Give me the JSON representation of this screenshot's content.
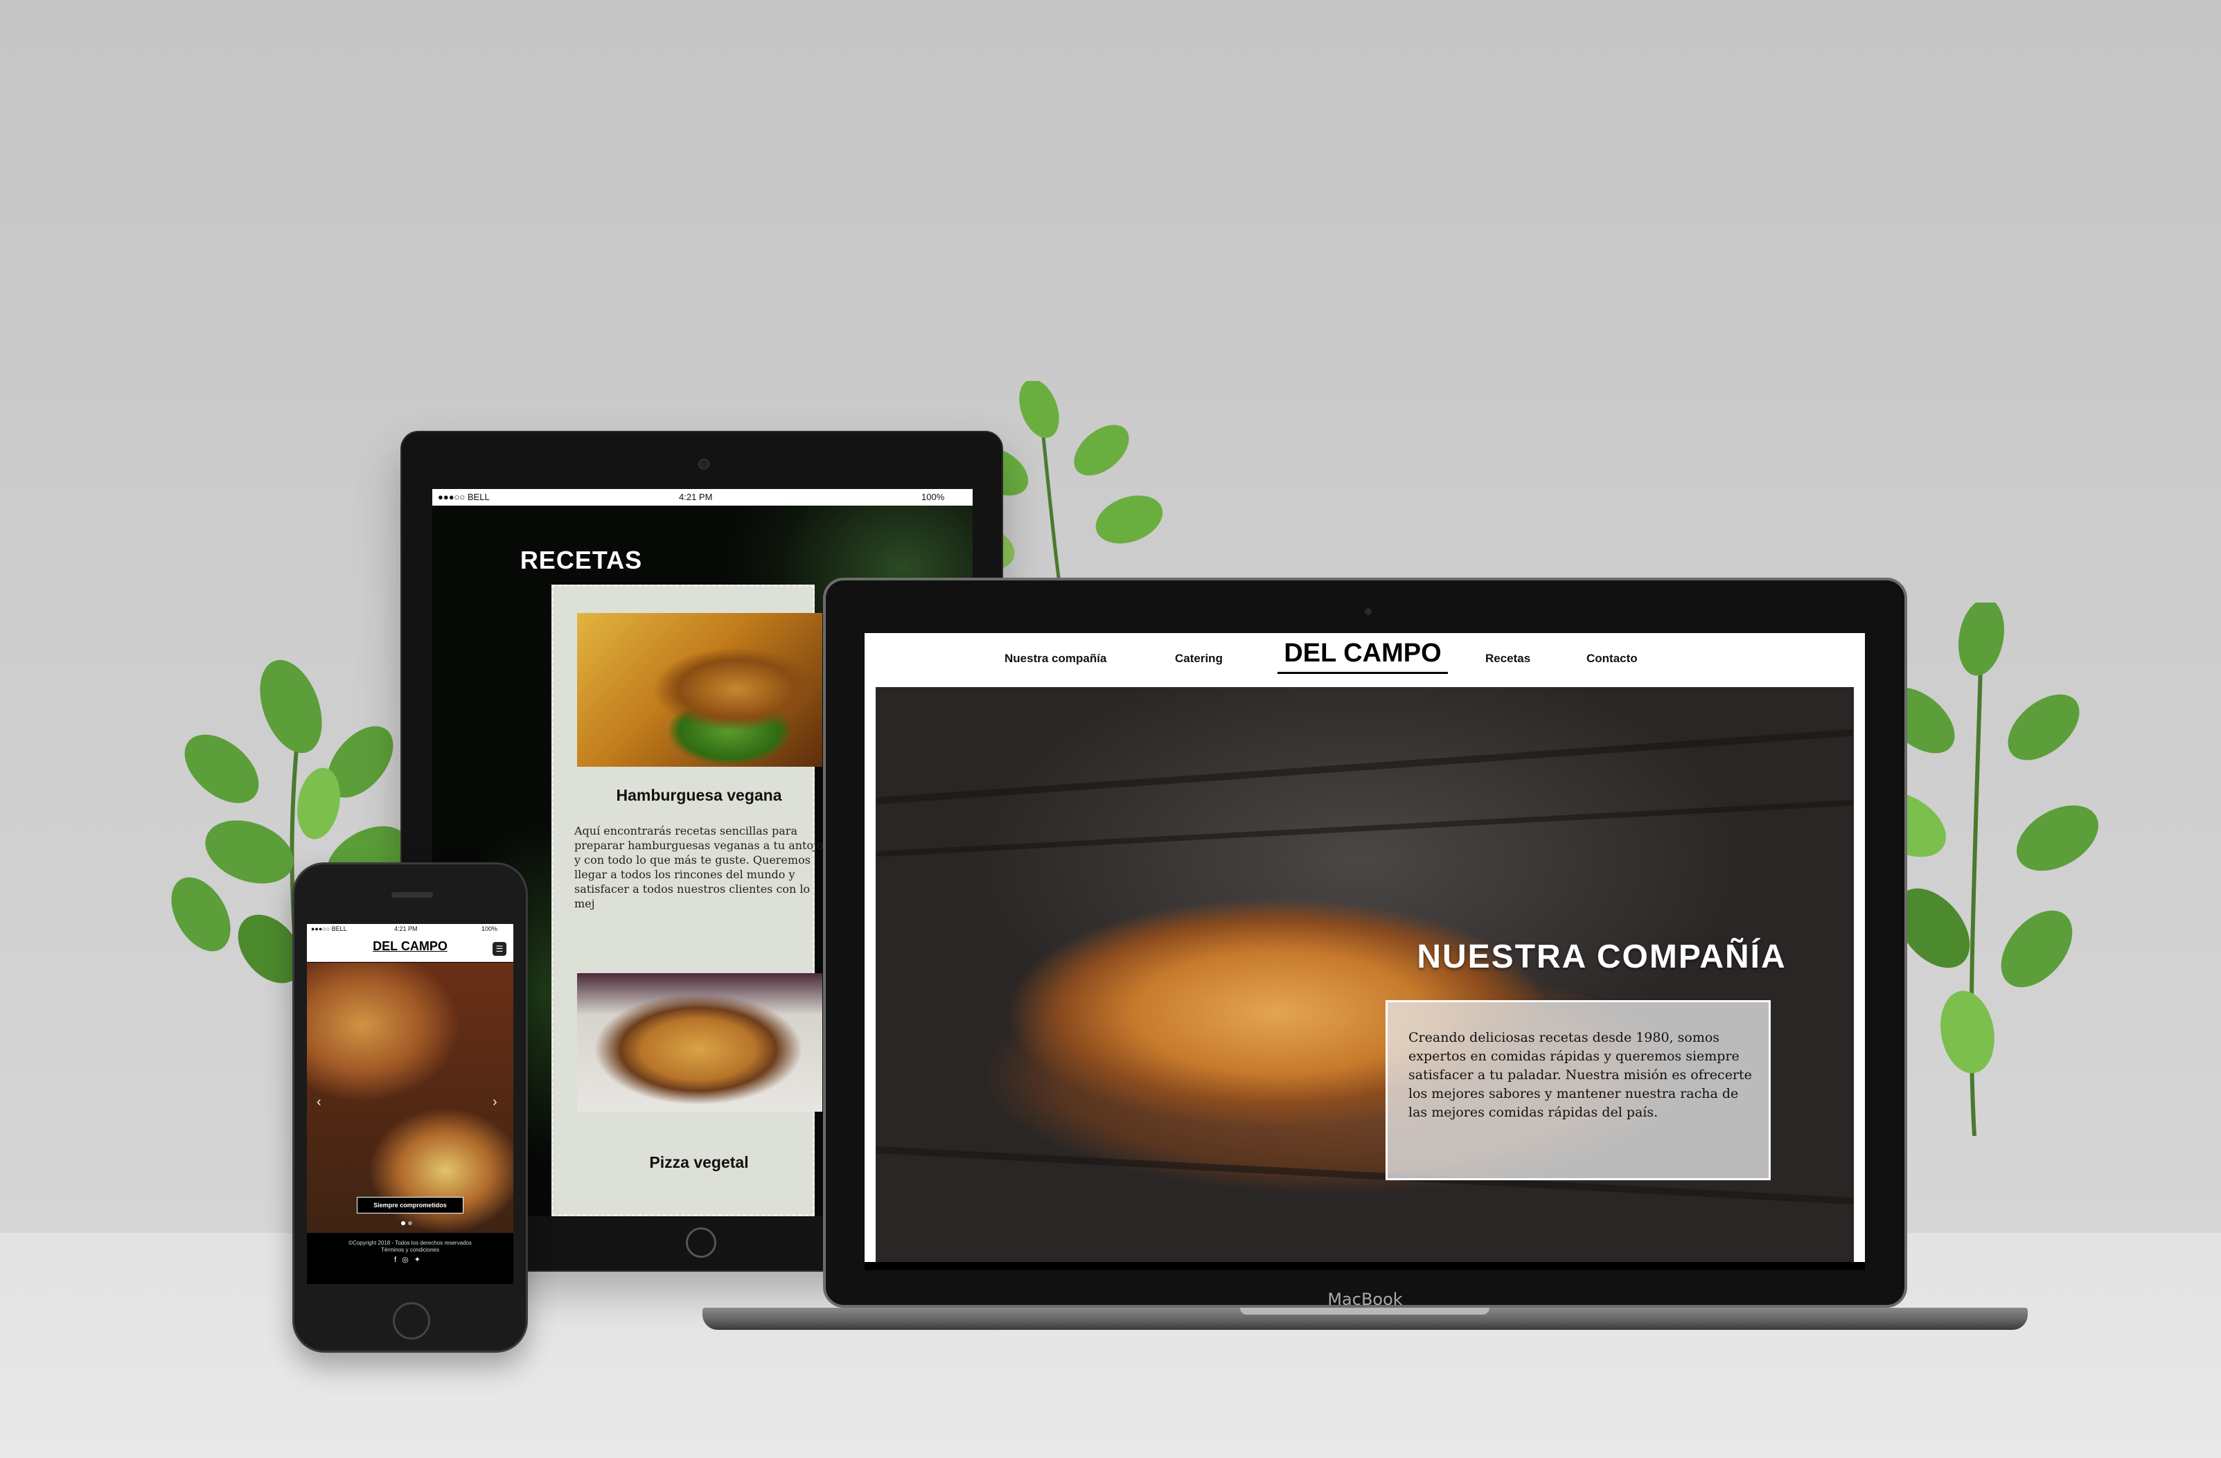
{
  "tablet": {
    "status": {
      "carrier": "●●●○○ BELL",
      "time": "4:21 PM",
      "battery": "100%"
    },
    "title": "RECETAS",
    "recipes": [
      {
        "title": "Hamburguesa vegana",
        "description": "Aquí encontrarás recetas sencillas para preparar hamburguesas veganas a tu antojo y con todo lo que más te guste. Queremos llegar a todos los rincones del mundo y satisfacer a todos nuestros clientes con lo mej"
      },
      {
        "title": "Pizza vegetal"
      }
    ]
  },
  "phone": {
    "status": {
      "carrier": "●●●○○ BELL",
      "time": "4:21 PM",
      "battery": "100%"
    },
    "logo": "DEL CAMPO",
    "cta": "Siempre comprometidos",
    "footer_line1": "©Copyright 2018 - Todos los derechos reservados",
    "footer_line2": "Términos y condiciones"
  },
  "laptop": {
    "nav": {
      "company": "Nuestra compañía",
      "catering": "Catering",
      "logo": "DEL CAMPO",
      "recipes": "Recetas",
      "contact": "Contacto"
    },
    "hero": {
      "heading": "NUESTRA COMPAÑÍA",
      "text": "Creando deliciosas recetas desde 1980, somos expertos en comidas rápidas y queremos siempre satisfacer a tu paladar.  Nuestra misión es ofrecerte los mejores sabores y mantener nuestra racha de las mejores comidas rápidas del país."
    },
    "brand": "MacBook"
  }
}
